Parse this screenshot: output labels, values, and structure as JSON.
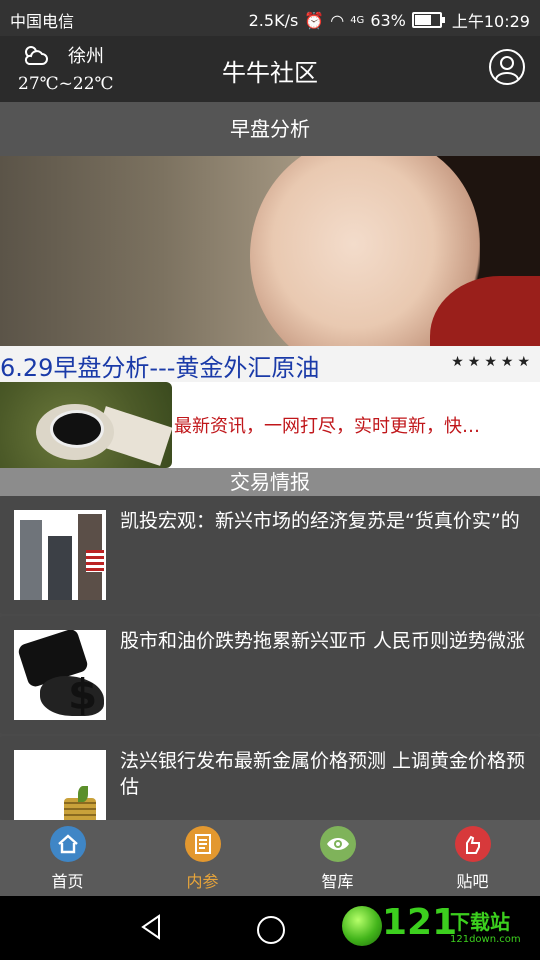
{
  "status": {
    "carrier": "中国电信",
    "net_speed": "2.5K/s",
    "signal_label": "4G",
    "battery": "63%",
    "battery_level": 0.63,
    "time": "上午10:29"
  },
  "header": {
    "city": "徐州",
    "temperature": "27℃~22℃",
    "title": "牛牛社区"
  },
  "sections": {
    "morning": "早盘分析",
    "trade": "交易情报"
  },
  "banner": {
    "headline": "6.29早盘分析---黄金外汇原油",
    "rating": "★★★★★"
  },
  "promo": {
    "text": "最新资讯，一网打尽，实时更新，快…"
  },
  "news": [
    {
      "title": "凯投宏观：新兴市场的经济复苏是“货真价实”的"
    },
    {
      "title": "股市和油价跌势拖累新兴亚币 人民币则逆势微涨"
    },
    {
      "title": "法兴银行发布最新金属价格预测 上调黄金价格预估"
    }
  ],
  "tabs": [
    {
      "label": "首页",
      "icon": "home-icon",
      "color": "#3f86c6"
    },
    {
      "label": "内参",
      "icon": "document-icon",
      "color": "#e3982f"
    },
    {
      "label": "智库",
      "icon": "eye-icon",
      "color": "#7fb35a"
    },
    {
      "label": "贴吧",
      "icon": "hand-icon",
      "color": "#d7393b"
    }
  ],
  "active_tab": "内参",
  "watermark": {
    "number": "121",
    "text": "下载站",
    "url": "121down.com"
  }
}
